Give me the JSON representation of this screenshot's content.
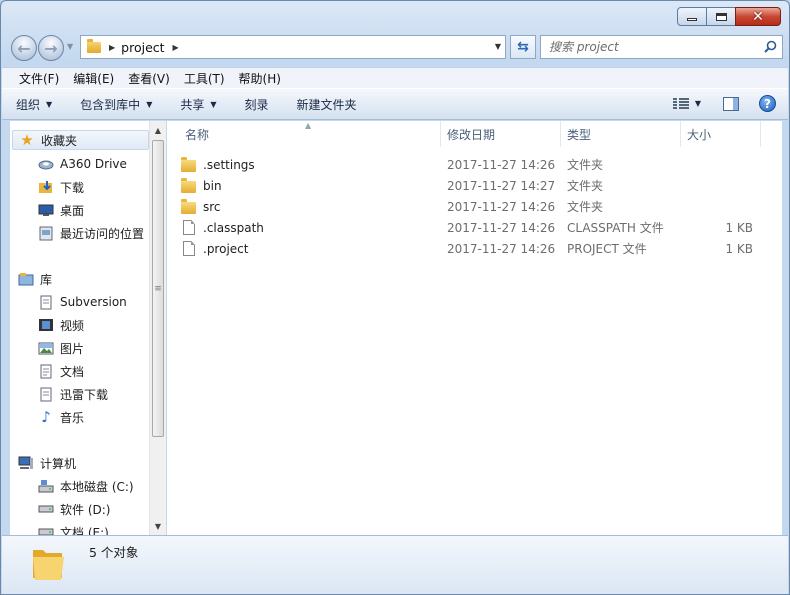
{
  "window": {
    "caption": {
      "minimize": "minimize",
      "maximize": "maximize",
      "close": "close"
    }
  },
  "address": {
    "crumb": "project"
  },
  "search": {
    "placeholder": "搜索 project"
  },
  "menu": [
    "文件(F)",
    "编辑(E)",
    "查看(V)",
    "工具(T)",
    "帮助(H)"
  ],
  "commands": {
    "organize": "组织",
    "include_library": "包含到库中",
    "share": "共享",
    "burn": "刻录",
    "new_folder": "新建文件夹"
  },
  "navpane": {
    "favorites": {
      "label": "收藏夹",
      "items": [
        "A360 Drive",
        "下载",
        "桌面",
        "最近访问的位置"
      ]
    },
    "libraries": {
      "label": "库",
      "items": [
        "Subversion",
        "视频",
        "图片",
        "文档",
        "迅雷下载",
        "音乐"
      ]
    },
    "computer": {
      "label": "计算机",
      "items": [
        "本地磁盘 (C:)",
        "软件 (D:)",
        "文档 (E:)"
      ]
    }
  },
  "columns": {
    "name": "名称",
    "date": "修改日期",
    "type": "类型",
    "size": "大小"
  },
  "files": [
    {
      "name": ".settings",
      "date": "2017-11-27 14:26",
      "type": "文件夹",
      "size": "",
      "kind": "folder"
    },
    {
      "name": "bin",
      "date": "2017-11-27 14:27",
      "type": "文件夹",
      "size": "",
      "kind": "folder"
    },
    {
      "name": "src",
      "date": "2017-11-27 14:26",
      "type": "文件夹",
      "size": "",
      "kind": "folder"
    },
    {
      "name": ".classpath",
      "date": "2017-11-27 14:26",
      "type": "CLASSPATH 文件",
      "size": "1 KB",
      "kind": "file"
    },
    {
      "name": ".project",
      "date": "2017-11-27 14:26",
      "type": "PROJECT 文件",
      "size": "1 KB",
      "kind": "file"
    }
  ],
  "status": {
    "count": "5 个对象"
  },
  "colors": {
    "accent": "#2a6ab3",
    "folder": "#e3ad32",
    "frame": "#c4d8ef"
  }
}
